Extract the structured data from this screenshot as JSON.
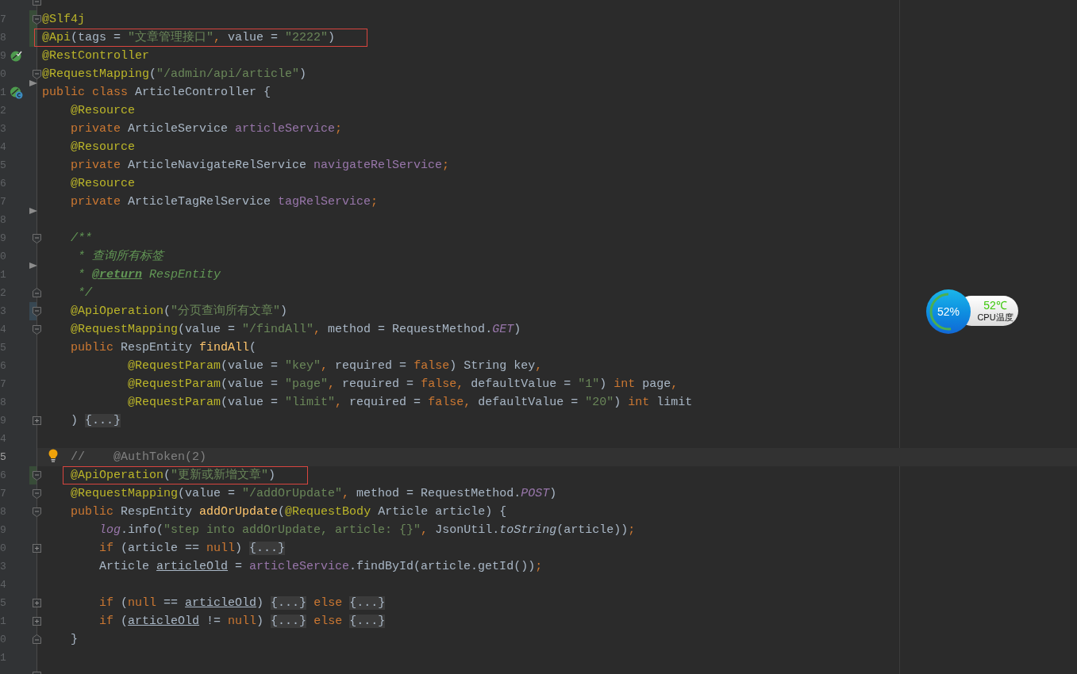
{
  "editor": {
    "lines": [
      {
        "gutter": [
          {
            "kind": "fold-end"
          }
        ]
      },
      {
        "number": "7",
        "gutter": [
          {
            "kind": "fold-start"
          },
          {
            "kind": "added"
          }
        ],
        "tokens": [
          {
            "kind": "ann",
            "text": "@Slf4j"
          }
        ]
      },
      {
        "number": "8",
        "gutter": [
          {
            "kind": "added"
          }
        ],
        "boxed": true,
        "tokens": [
          {
            "kind": "ann",
            "text": "@Api"
          },
          {
            "kind": "plain",
            "text": "(tags = "
          },
          {
            "kind": "str",
            "text": "\"文章管理接口\""
          },
          {
            "kind": "kw",
            "text": ", "
          },
          {
            "kind": "plain",
            "text": "value = "
          },
          {
            "kind": "str",
            "text": "\"2222\""
          },
          {
            "kind": "plain",
            "text": ")"
          }
        ]
      },
      {
        "number": "9",
        "gutter": [
          {
            "kind": "bean"
          }
        ],
        "tokens": [
          {
            "kind": "ann",
            "text": "@RestController"
          }
        ]
      },
      {
        "number": "0",
        "gutter": [
          {
            "kind": "fold-start"
          }
        ],
        "tokens": [
          {
            "kind": "ann",
            "text": "@RequestMapping"
          },
          {
            "kind": "plain",
            "text": "("
          },
          {
            "kind": "str",
            "text": "\"/admin/api/article\""
          },
          {
            "kind": "plain",
            "text": ")"
          }
        ]
      },
      {
        "number": "1",
        "gutter": [
          {
            "kind": "bean-class"
          },
          {
            "kind": "arrow"
          }
        ],
        "tokens": [
          {
            "kind": "kw",
            "text": "public class "
          },
          {
            "kind": "plain",
            "text": "ArticleController {"
          }
        ]
      },
      {
        "number": "2",
        "tokens": [
          {
            "kind": "ann",
            "text": "    @Resource"
          }
        ]
      },
      {
        "number": "3",
        "tokens": [
          {
            "kind": "kw",
            "text": "    private "
          },
          {
            "kind": "plain",
            "text": "ArticleService "
          },
          {
            "kind": "field",
            "text": "articleService"
          },
          {
            "kind": "kw",
            "text": ";"
          }
        ]
      },
      {
        "number": "4",
        "tokens": [
          {
            "kind": "ann",
            "text": "    @Resource"
          }
        ]
      },
      {
        "number": "5",
        "tokens": [
          {
            "kind": "kw",
            "text": "    private "
          },
          {
            "kind": "plain",
            "text": "ArticleNavigateRelService "
          },
          {
            "kind": "field",
            "text": "navigateRelService"
          },
          {
            "kind": "kw",
            "text": ";"
          }
        ]
      },
      {
        "number": "6",
        "tokens": [
          {
            "kind": "ann",
            "text": "    @Resource"
          }
        ]
      },
      {
        "number": "7",
        "tokens": [
          {
            "kind": "kw",
            "text": "    private "
          },
          {
            "kind": "plain",
            "text": "ArticleTagRelService "
          },
          {
            "kind": "field",
            "text": "tagRelService"
          },
          {
            "kind": "kw",
            "text": ";"
          }
        ]
      },
      {
        "number": "8",
        "gutter": [
          {
            "kind": "arrow"
          }
        ]
      },
      {
        "number": "9",
        "gutter": [
          {
            "kind": "fold-start"
          }
        ],
        "tokens": [
          {
            "kind": "doc",
            "text": "    /**"
          }
        ]
      },
      {
        "number": "0",
        "tokens": [
          {
            "kind": "doc",
            "text": "     * 查询所有标签"
          }
        ]
      },
      {
        "number": "1",
        "gutter": [
          {
            "kind": "arrow"
          }
        ],
        "tokens": [
          {
            "kind": "doc",
            "text": "     * "
          },
          {
            "kind": "doctag",
            "text": "@return"
          },
          {
            "kind": "doc",
            "text": " RespEntity"
          }
        ]
      },
      {
        "number": "2",
        "gutter": [
          {
            "kind": "fold-end"
          }
        ],
        "tokens": [
          {
            "kind": "doc",
            "text": "     */"
          }
        ]
      },
      {
        "number": "3",
        "gutter": [
          {
            "kind": "fold-start"
          },
          {
            "kind": "modified"
          }
        ],
        "tokens": [
          {
            "kind": "ann",
            "text": "    @ApiOperation"
          },
          {
            "kind": "plain",
            "text": "("
          },
          {
            "kind": "str",
            "text": "\"分页查询所有文章\""
          },
          {
            "kind": "plain",
            "text": ")"
          }
        ]
      },
      {
        "number": "4",
        "gutter": [
          {
            "kind": "fold-start"
          }
        ],
        "tokens": [
          {
            "kind": "ann",
            "text": "    @RequestMapping"
          },
          {
            "kind": "plain",
            "text": "(value = "
          },
          {
            "kind": "str",
            "text": "\"/findAll\""
          },
          {
            "kind": "kw",
            "text": ", "
          },
          {
            "kind": "plain",
            "text": "method = RequestMethod."
          },
          {
            "kind": "static",
            "text": "GET"
          },
          {
            "kind": "plain",
            "text": ")"
          }
        ]
      },
      {
        "number": "5",
        "tokens": [
          {
            "kind": "kw",
            "text": "    public "
          },
          {
            "kind": "plain",
            "text": "RespEntity "
          },
          {
            "kind": "method",
            "text": "findAll"
          },
          {
            "kind": "plain",
            "text": "("
          }
        ]
      },
      {
        "number": "6",
        "tokens": [
          {
            "kind": "ann",
            "text": "            @RequestParam"
          },
          {
            "kind": "plain",
            "text": "(value = "
          },
          {
            "kind": "str",
            "text": "\"key\""
          },
          {
            "kind": "kw",
            "text": ", "
          },
          {
            "kind": "plain",
            "text": "required = "
          },
          {
            "kind": "kw",
            "text": "false"
          },
          {
            "kind": "plain",
            "text": ") String key"
          },
          {
            "kind": "kw",
            "text": ","
          }
        ]
      },
      {
        "number": "7",
        "tokens": [
          {
            "kind": "ann",
            "text": "            @RequestParam"
          },
          {
            "kind": "plain",
            "text": "(value = "
          },
          {
            "kind": "str",
            "text": "\"page\""
          },
          {
            "kind": "kw",
            "text": ", "
          },
          {
            "kind": "plain",
            "text": "required = "
          },
          {
            "kind": "kw",
            "text": "false, "
          },
          {
            "kind": "plain",
            "text": "defaultValue = "
          },
          {
            "kind": "str",
            "text": "\"1\""
          },
          {
            "kind": "plain",
            "text": ") "
          },
          {
            "kind": "kw",
            "text": "int "
          },
          {
            "kind": "plain",
            "text": "page"
          },
          {
            "kind": "kw",
            "text": ","
          }
        ]
      },
      {
        "number": "8",
        "tokens": [
          {
            "kind": "ann",
            "text": "            @RequestParam"
          },
          {
            "kind": "plain",
            "text": "(value = "
          },
          {
            "kind": "str",
            "text": "\"limit\""
          },
          {
            "kind": "kw",
            "text": ", "
          },
          {
            "kind": "plain",
            "text": "required = "
          },
          {
            "kind": "kw",
            "text": "false, "
          },
          {
            "kind": "plain",
            "text": "defaultValue = "
          },
          {
            "kind": "str",
            "text": "\"20\""
          },
          {
            "kind": "plain",
            "text": ") "
          },
          {
            "kind": "kw",
            "text": "int "
          },
          {
            "kind": "plain",
            "text": "limit"
          }
        ]
      },
      {
        "number": "9",
        "gutter": [
          {
            "kind": "fold-collapsed"
          }
        ],
        "tokens": [
          {
            "kind": "plain",
            "text": "    ) "
          },
          {
            "kind": "folded",
            "text": "{...}"
          }
        ]
      },
      {
        "number": "4"
      },
      {
        "number": "5",
        "current": true,
        "gutter": [
          {
            "kind": "bulb"
          }
        ],
        "tokens": [
          {
            "kind": "comment",
            "text": "    //    @AuthToken(2)"
          }
        ]
      },
      {
        "number": "6",
        "gutter": [
          {
            "kind": "fold-start"
          },
          {
            "kind": "added"
          }
        ],
        "boxed": true,
        "tokens": [
          {
            "kind": "ann",
            "text": "    @ApiOperation"
          },
          {
            "kind": "plain",
            "text": "("
          },
          {
            "kind": "str",
            "text": "\"更新或新增文章\""
          },
          {
            "kind": "plain",
            "text": ")"
          }
        ]
      },
      {
        "number": "7",
        "gutter": [
          {
            "kind": "fold-start"
          }
        ],
        "tokens": [
          {
            "kind": "ann",
            "text": "    @RequestMapping"
          },
          {
            "kind": "plain",
            "text": "(value = "
          },
          {
            "kind": "str",
            "text": "\"/addOrUpdate\""
          },
          {
            "kind": "kw",
            "text": ", "
          },
          {
            "kind": "plain",
            "text": "method = RequestMethod."
          },
          {
            "kind": "static",
            "text": "POST"
          },
          {
            "kind": "plain",
            "text": ")"
          }
        ]
      },
      {
        "number": "8",
        "gutter": [
          {
            "kind": "fold-start"
          }
        ],
        "tokens": [
          {
            "kind": "kw",
            "text": "    public "
          },
          {
            "kind": "plain",
            "text": "RespEntity "
          },
          {
            "kind": "method",
            "text": "addOrUpdate"
          },
          {
            "kind": "plain",
            "text": "("
          },
          {
            "kind": "ann",
            "text": "@RequestBody"
          },
          {
            "kind": "plain",
            "text": " Article article) {"
          }
        ]
      },
      {
        "number": "9",
        "tokens": [
          {
            "kind": "static",
            "text": "        log"
          },
          {
            "kind": "plain",
            "text": ".info("
          },
          {
            "kind": "str",
            "text": "\"step into addOrUpdate, article: {}\""
          },
          {
            "kind": "kw",
            "text": ", "
          },
          {
            "kind": "plain",
            "text": "JsonUtil."
          },
          {
            "kind": "call",
            "text": "toString"
          },
          {
            "kind": "plain",
            "text": "(article))"
          },
          {
            "kind": "kw",
            "text": ";"
          }
        ]
      },
      {
        "number": "0",
        "gutter": [
          {
            "kind": "fold-collapsed"
          }
        ],
        "tokens": [
          {
            "kind": "kw",
            "text": "        if "
          },
          {
            "kind": "plain",
            "text": "(article == "
          },
          {
            "kind": "kw",
            "text": "null"
          },
          {
            "kind": "plain",
            "text": ") "
          },
          {
            "kind": "folded",
            "text": "{...}"
          }
        ]
      },
      {
        "number": "3",
        "tokens": [
          {
            "kind": "plain",
            "text": "        Article "
          },
          {
            "kind": "var",
            "text": "articleOld"
          },
          {
            "kind": "plain",
            "text": " = "
          },
          {
            "kind": "field",
            "text": "articleService"
          },
          {
            "kind": "plain",
            "text": ".findById(article.getId())"
          },
          {
            "kind": "kw",
            "text": ";"
          }
        ]
      },
      {
        "number": "4"
      },
      {
        "number": "5",
        "gutter": [
          {
            "kind": "fold-collapsed"
          }
        ],
        "tokens": [
          {
            "kind": "kw",
            "text": "        if "
          },
          {
            "kind": "plain",
            "text": "("
          },
          {
            "kind": "kw",
            "text": "null"
          },
          {
            "kind": "plain",
            "text": " == "
          },
          {
            "kind": "var",
            "text": "articleOld"
          },
          {
            "kind": "plain",
            "text": ") "
          },
          {
            "kind": "folded",
            "text": "{...}"
          },
          {
            "kind": "kw",
            "text": " else "
          },
          {
            "kind": "folded",
            "text": "{...}"
          }
        ]
      },
      {
        "number": "1",
        "gutter": [
          {
            "kind": "fold-collapsed"
          }
        ],
        "tokens": [
          {
            "kind": "kw",
            "text": "        if "
          },
          {
            "kind": "plain",
            "text": "("
          },
          {
            "kind": "var",
            "text": "articleOld"
          },
          {
            "kind": "plain",
            "text": " != "
          },
          {
            "kind": "kw",
            "text": "null"
          },
          {
            "kind": "plain",
            "text": ") "
          },
          {
            "kind": "folded",
            "text": "{...}"
          },
          {
            "kind": "kw",
            "text": " else "
          },
          {
            "kind": "folded",
            "text": "{...}"
          }
        ]
      },
      {
        "number": "0",
        "gutter": [
          {
            "kind": "fold-end"
          }
        ],
        "tokens": [
          {
            "kind": "plain",
            "text": "    }"
          }
        ]
      },
      {
        "number": "1"
      },
      {
        "gutter": [
          {
            "kind": "fold-start"
          }
        ]
      }
    ]
  },
  "cpu_widget": {
    "percent": "52%",
    "level": 0.52,
    "temperature": "52℃",
    "label": "CPU温度"
  }
}
